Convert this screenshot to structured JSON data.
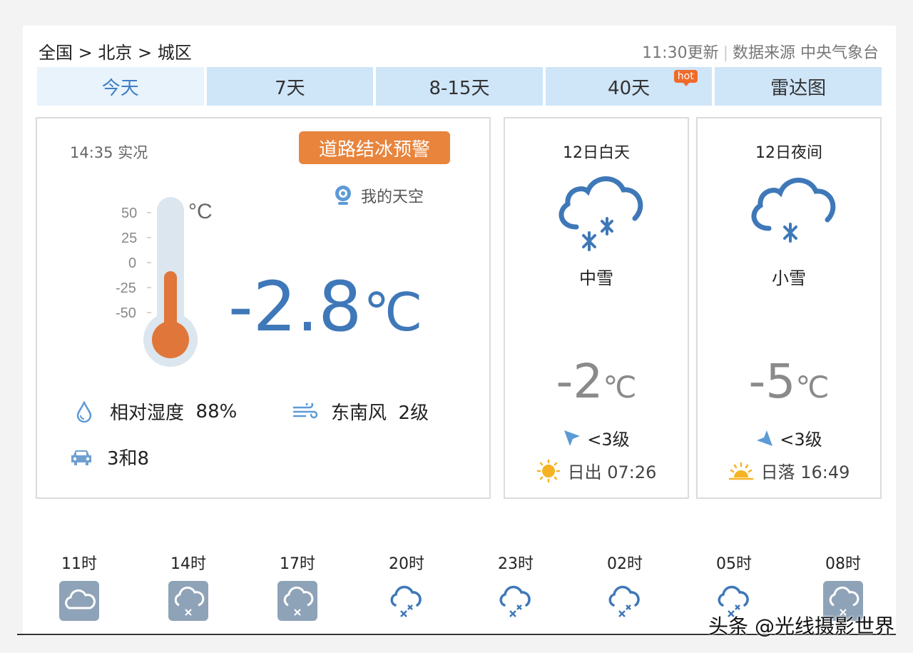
{
  "header": {
    "breadcrumb": "全国 > 北京 > 城区",
    "update_time": "11:30更新",
    "source": "数据来源 中央气象台"
  },
  "tabs": [
    {
      "label": "今天",
      "active": true
    },
    {
      "label": "7天"
    },
    {
      "label": "8-15天"
    },
    {
      "label": "40天",
      "badge": "hot"
    },
    {
      "label": "雷达图"
    }
  ],
  "now": {
    "time": "14:35 实况",
    "alert": "道路结冰预警",
    "my_sky": "我的天空",
    "thermometer": {
      "unit": "°C",
      "ticks": [
        "50",
        "25",
        "0",
        "-25",
        "-50"
      ],
      "level_percent": 48
    },
    "temperature": "-2.8",
    "temperature_unit": "℃",
    "humidity_label": "相对湿度",
    "humidity_value": "88%",
    "wind_dir": "东南风",
    "wind_level": "2级",
    "traffic": "3和8"
  },
  "day": {
    "title": "12日白天",
    "weather": "中雪",
    "temp": "-2",
    "unit": "℃",
    "wind": "<3级",
    "sun": "日出 07:26"
  },
  "night": {
    "title": "12日夜间",
    "weather": "小雪",
    "temp": "-5",
    "unit": "℃",
    "wind": "<3级",
    "sun": "日落 16:49"
  },
  "hourly": [
    {
      "label": "11时",
      "icon": "cloudy-icon"
    },
    {
      "label": "14时",
      "icon": "snow-icon"
    },
    {
      "label": "17时",
      "icon": "snow-icon"
    },
    {
      "label": "20时",
      "icon": "snow-outline-icon"
    },
    {
      "label": "23时",
      "icon": "snow-outline-icon"
    },
    {
      "label": "02时",
      "icon": "snow-outline-icon"
    },
    {
      "label": "05时",
      "icon": "snow-outline-icon"
    },
    {
      "label": "08时",
      "icon": "snow-icon"
    }
  ],
  "watermark": "头条 @光线摄影世界",
  "colors": {
    "accent": "#3f78b8",
    "tab_bg": "#cfe5f8",
    "alert": "#e8843c",
    "thermo": "#e0763a"
  }
}
